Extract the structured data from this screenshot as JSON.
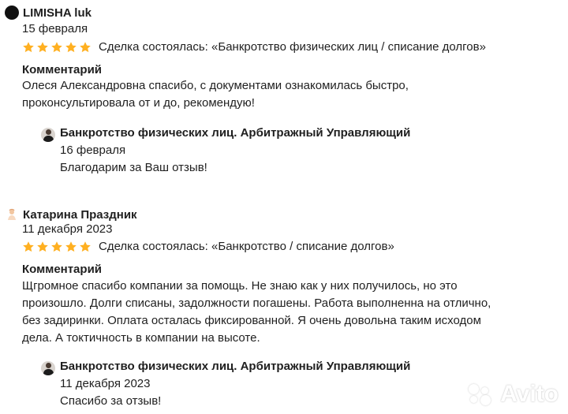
{
  "reviews": [
    {
      "author": "LIMISHA luk",
      "date": "15 февраля",
      "rating": 5,
      "deal": "Сделка состоялась: «Банкротство физических лиц / списание долгов»",
      "comment_label": "Комментарий",
      "comment_lines": [
        "Олеся Александровна спасибо, с документами ознакомилась быстро,",
        "проконсультировала от и до, рекомендую!"
      ],
      "reply": {
        "name": "Банкротство физических лиц. Арбитражный Управляющий",
        "date": "16 февраля",
        "text": "Благодарим за Ваш отзыв!"
      }
    },
    {
      "author": "Катарина Праздник",
      "date": "11 декабря 2023",
      "rating": 5,
      "deal": "Сделка состоялась: «Банкротство / списание долгов»",
      "comment_label": "Комментарий",
      "comment_lines": [
        "Щгромное спасибо компании за помощь. Не знаю как у них получилось, но это",
        "произошло. Долги списаны, задолжности погашены. Работа выполненна на отлично,",
        "без задиринки. Оплата осталась фиксированной. Я очень довольна таким исходом",
        "дела. А токтичность в компании на высоте."
      ],
      "reply": {
        "name": "Банкротство физических лиц. Арбитражный Управляющий",
        "date": "11 декабря 2023",
        "text": "Спасибо за отзыв!"
      }
    }
  ],
  "watermark": "Avito",
  "colors": {
    "star": "#ffb021",
    "text": "#1f1f1f"
  },
  "icons": {
    "star": "star-icon",
    "avatar": "avatar-icon"
  }
}
